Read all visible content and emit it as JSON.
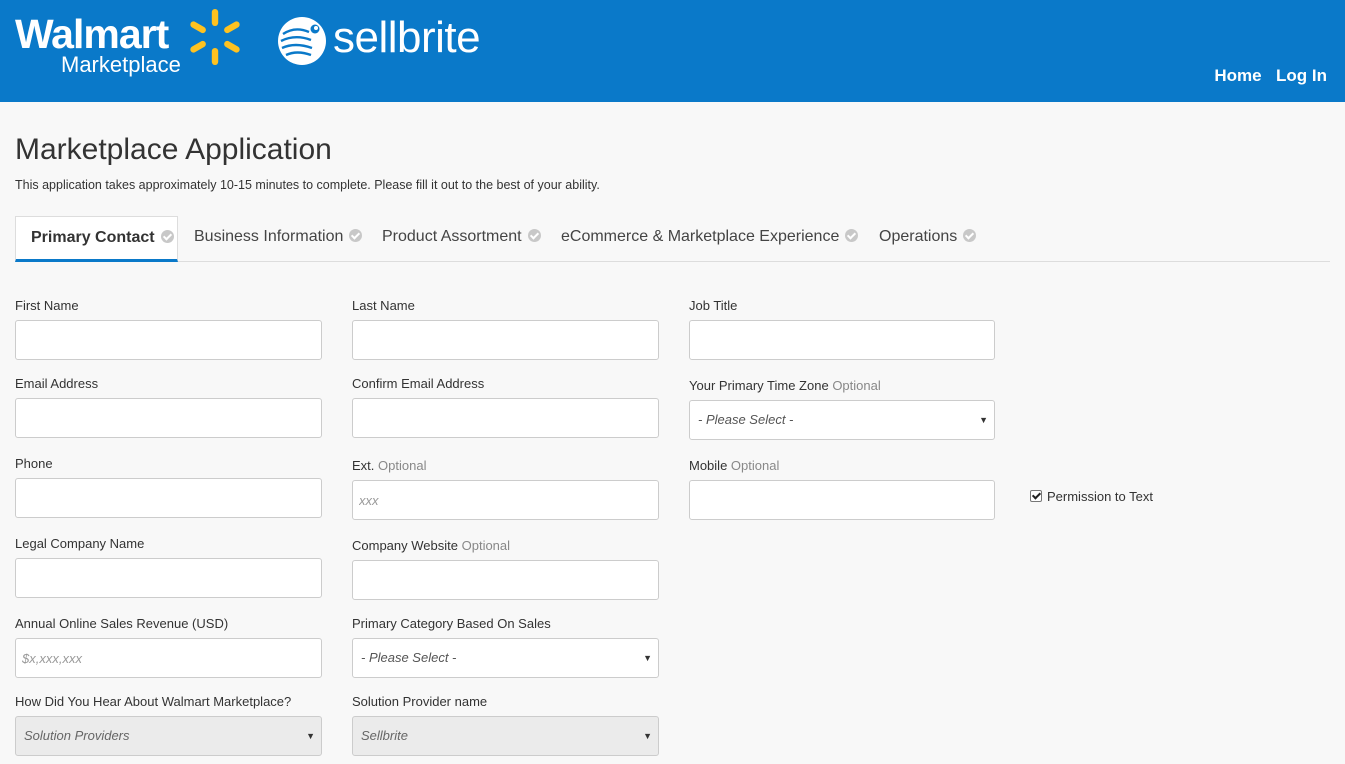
{
  "header": {
    "walmart_logo": {
      "word": "Walmart",
      "sub": "Marketplace",
      "spark_color": "#ffc220"
    },
    "sellbrite_logo": {
      "word": "sellbrite"
    },
    "nav": [
      {
        "label": "Home"
      },
      {
        "label": "Log In"
      }
    ],
    "bg_color": "#0a79c9"
  },
  "page": {
    "title": "Marketplace Application",
    "subtitle": "This application takes approximately 10-15 minutes to complete. Please fill it out to the best of your ability."
  },
  "tabs": [
    {
      "label": "Primary Contact",
      "active": true
    },
    {
      "label": "Business Information",
      "active": false
    },
    {
      "label": "Product Assortment",
      "active": false
    },
    {
      "label": "eCommerce & Marketplace Experience",
      "active": false
    },
    {
      "label": "Operations",
      "active": false
    }
  ],
  "form": {
    "first_name": {
      "label": "First Name",
      "value": ""
    },
    "last_name": {
      "label": "Last Name",
      "value": ""
    },
    "job_title": {
      "label": "Job Title",
      "value": ""
    },
    "email": {
      "label": "Email Address",
      "value": ""
    },
    "confirm_email": {
      "label": "Confirm Email Address",
      "value": ""
    },
    "time_zone": {
      "label": "Your Primary Time Zone",
      "optional": "Optional",
      "selected": "- Please Select -"
    },
    "phone": {
      "label": "Phone",
      "value": ""
    },
    "ext": {
      "label": "Ext.",
      "optional": "Optional",
      "placeholder": "xxx"
    },
    "mobile": {
      "label": "Mobile",
      "optional": "Optional",
      "value": ""
    },
    "permission_to_text": {
      "label": "Permission to Text",
      "checked": true
    },
    "legal_company": {
      "label": "Legal Company Name",
      "value": ""
    },
    "company_website": {
      "label": "Company Website",
      "optional": "Optional",
      "value": ""
    },
    "annual_revenue": {
      "label": "Annual Online Sales Revenue (USD)",
      "placeholder": "$x,xxx,xxx"
    },
    "primary_category": {
      "label": "Primary Category Based On Sales",
      "selected": "- Please Select -"
    },
    "how_heard": {
      "label": "How Did You Hear About Walmart Marketplace?",
      "selected": "Solution Providers"
    },
    "solution_provider": {
      "label": "Solution Provider name",
      "selected": "Sellbrite"
    }
  }
}
